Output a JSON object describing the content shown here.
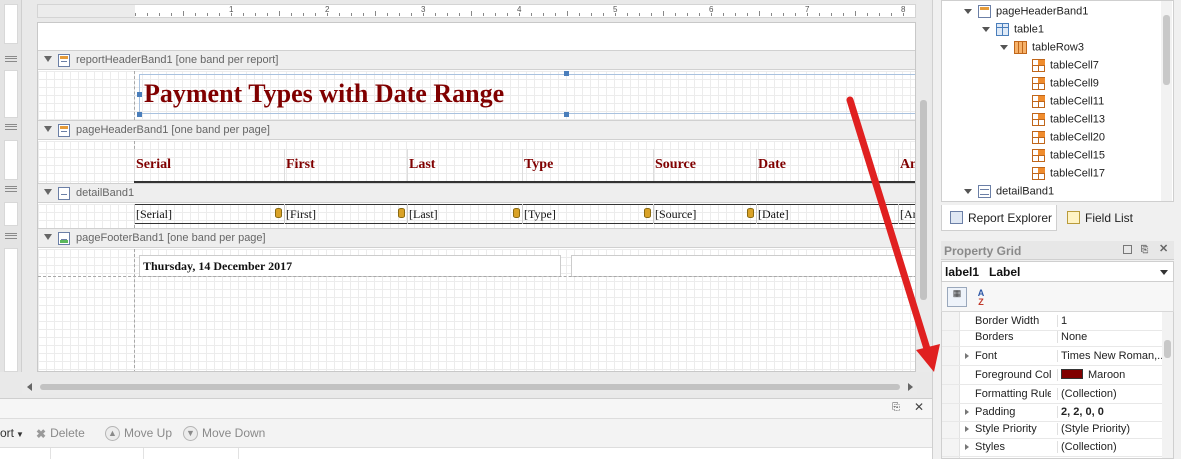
{
  "ruler": {
    "numbers": [
      "1",
      "2",
      "3",
      "4",
      "5",
      "6",
      "7",
      "8"
    ]
  },
  "bands": {
    "report_header": "reportHeaderBand1 [one band per report]",
    "page_header": "pageHeaderBand1 [one band per page]",
    "detail": "detailBand1",
    "page_footer": "pageFooterBand1 [one band per page]"
  },
  "report": {
    "title": "Payment Types with Date Range",
    "header_cells": [
      "Serial",
      "First",
      "Last",
      "Type",
      "Source",
      "Date",
      "Am"
    ],
    "detail_cells": [
      "[Serial]",
      "[First]",
      "[Last]",
      "[Type]",
      "[Source]",
      "[Date]",
      "[Am"
    ],
    "footer_date": "Thursday, 14 December 2017"
  },
  "bottom_toolbar": {
    "first_label": "ort",
    "delete_label": "Delete",
    "move_up_label": "Move Up",
    "move_down_label": "Move Down"
  },
  "report_explorer": {
    "tree": [
      {
        "label": "pageHeaderBand1",
        "icon": "band-icon"
      },
      {
        "label": "table1",
        "icon": "table-icon"
      },
      {
        "label": "tableRow3",
        "icon": "table-row-icon"
      },
      {
        "label": "tableCell7",
        "icon": "table-cell-icon"
      },
      {
        "label": "tableCell9",
        "icon": "table-cell-icon"
      },
      {
        "label": "tableCell11",
        "icon": "table-cell-icon"
      },
      {
        "label": "tableCell13",
        "icon": "table-cell-icon"
      },
      {
        "label": "tableCell20",
        "icon": "table-cell-icon"
      },
      {
        "label": "tableCell15",
        "icon": "table-cell-icon"
      },
      {
        "label": "tableCell17",
        "icon": "table-cell-icon"
      },
      {
        "label": "detailBand1",
        "icon": "band-icon"
      }
    ],
    "tabs": [
      "Report Explorer",
      "Field List"
    ]
  },
  "property_grid": {
    "title": "Property Grid",
    "object_name": "label1",
    "object_type": "Label",
    "rows": [
      {
        "name": "Border Width",
        "value": "1"
      },
      {
        "name": "Borders",
        "value": "None"
      },
      {
        "name": "Font",
        "value": "Times New Roman,..."
      },
      {
        "name": "Foreground Colo",
        "value": "Maroon"
      },
      {
        "name": "Formatting Rule",
        "value": "(Collection)"
      },
      {
        "name": "Padding",
        "value": "2, 2, 0, 0"
      },
      {
        "name": "Style Priority",
        "value": "(Style Priority)"
      },
      {
        "name": "Styles",
        "value": "(Collection)"
      }
    ]
  },
  "colors": {
    "title_text": "#800000",
    "annotation_arrow": "#e02020",
    "maroon_swatch": "#800000"
  }
}
